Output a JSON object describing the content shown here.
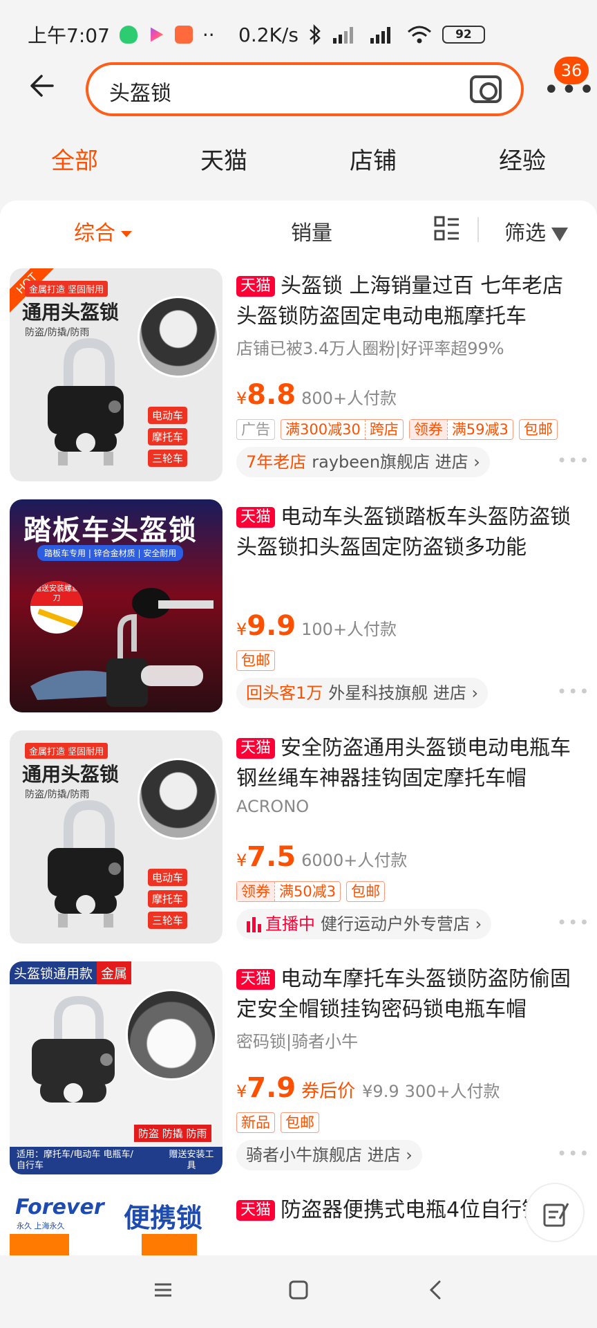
{
  "status_bar": {
    "time": "上午7:07",
    "net_speed": "0.2K/s",
    "battery": "92",
    "more": "··"
  },
  "search": {
    "query": "头盔锁",
    "cart_badge": "36"
  },
  "top_tabs": [
    "全部",
    "天猫",
    "店铺",
    "经验"
  ],
  "sort_bar": {
    "comprehensive": "综合",
    "sales": "销量",
    "filter": "筛选"
  },
  "products": [
    {
      "badge": "天猫",
      "title": "头盔锁 上海销量过百 七年老店头盔锁防盗固定电动电瓶摩托车",
      "subtitle": "店铺已被3.4万人圈粉|好评率超99%",
      "price": "8.8",
      "paid": "800+人付款",
      "tags": [
        "广告",
        "满300减30",
        "跨店",
        "领券",
        "满59减3",
        "包邮"
      ],
      "store_highlight": "7年老店",
      "store": "raybeen旗舰店 进店"
    },
    {
      "badge": "天猫",
      "title": "电动车头盔锁踏板车头盔防盗锁头盔锁扣头盔固定防盗锁多功能",
      "subtitle": "",
      "price": "9.9",
      "paid": "100+人付款",
      "tags": [
        "包邮"
      ],
      "store_highlight": "回头客1万",
      "store": "外星科技旗舰 进店"
    },
    {
      "badge": "天猫",
      "title": "安全防盗通用头盔锁电动电瓶车钢丝绳车神器挂钩固定摩托车帽",
      "subtitle": "ACRONO",
      "price": "7.5",
      "paid": "6000+人付款",
      "tags": [
        "领券",
        "满50减3",
        "包邮"
      ],
      "store_highlight": "直播中",
      "store": "健行运动户外专营店"
    },
    {
      "badge": "天猫",
      "title": "电动车摩托车头盔锁防盗防偷固定安全帽锁挂钩密码锁电瓶车帽",
      "subtitle": "密码锁|骑者小牛",
      "price": "7.9",
      "coupon_after": "券后价",
      "orig_price": "¥9.9",
      "paid": "300+人付款",
      "tags": [
        "新品",
        "包邮"
      ],
      "store_highlight": "",
      "store": "骑者小牛旗舰店 进店"
    },
    {
      "badge": "天猫",
      "title": "防盗器便携式电瓶4位自行锁"
    }
  ],
  "thumb_texts": {
    "p1_main": "通用头盔锁",
    "p1_top": "金属打造 坚固耐用",
    "p1_sub": "防盗/防撬/防雨",
    "p1_tags": [
      "电动车",
      "摩托车",
      "三轮车"
    ],
    "p1_hot": "HOT",
    "p2_main": "踏板车头盔锁",
    "p2_bar": "踏板车专用 | 锌合金材质 | 安全耐用",
    "p2_gift": "赠送安装螺丝刀",
    "p4_top": "头盔锁通用款",
    "p4_metal": "金属",
    "p4_feat": "防盗 防撬 防雨",
    "p4_foot1": "适用：摩托车/电动车 电瓶车/自行车",
    "p4_foot2": "赠送安装工具",
    "p5_brand": "Forever",
    "p5_brand_sub": "永久 上海永久",
    "p5_main": "便携锁"
  },
  "colors": {
    "accent": "#ff5000",
    "tmall": "#ff0036"
  }
}
